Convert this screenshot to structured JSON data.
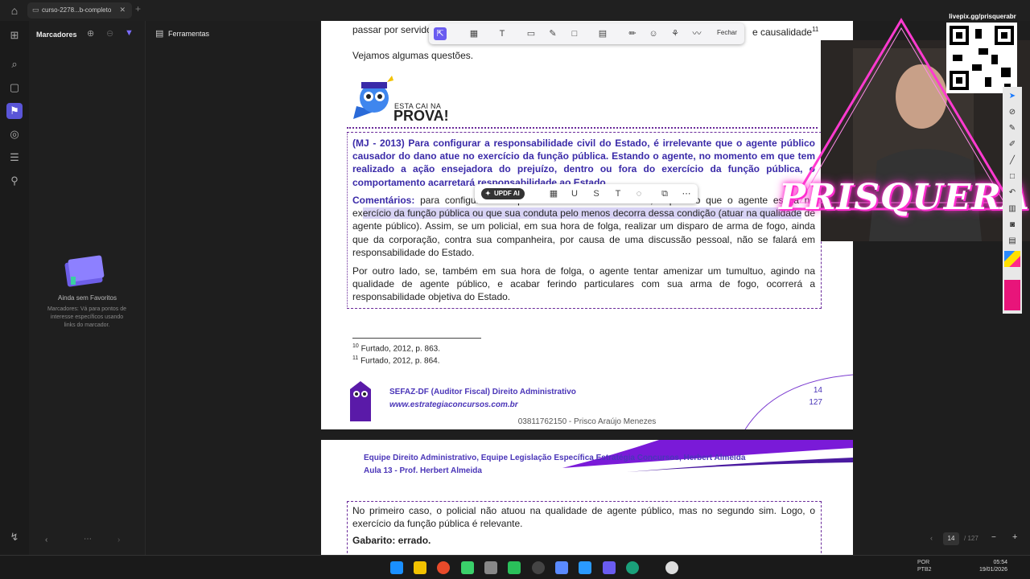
{
  "titlebar": {
    "tab_title": "curso-2278...b-completo"
  },
  "sidebar": {
    "title": "Marcadores",
    "empty_title": "Ainda sem Favoritos",
    "empty_desc": "Marcadores: Vá para pontos de interesse específicos usando links do marcador."
  },
  "tools": {
    "label": "Ferramentas"
  },
  "annotation_toolbar": {
    "close_label": "Fechar"
  },
  "selection_toolbar": {
    "ai_label": "UPDF AI"
  },
  "document": {
    "top_line_start": "passar por servido",
    "top_line_end": "e causalidade",
    "top_sup": "11",
    "intro": "Vejamos algumas questões.",
    "badge_small": "ESTA CAI NA",
    "badge_big": "PROVA!",
    "question": "(MJ - 2013) Para configurar a responsabilidade civil do Estado, é irrelevante que o agente público causador do dano atue no exercício da função pública. Estando o agente, no momento em que tem realizado a ação ensejadora do prejuízo, dentro ou fora do exercício da função pública, o comportamento acarretará responsabilidade ao Estado.",
    "comment_label": "Comentários:",
    "comment_pre": "para configurar a responsabilidade civil do Estado, é preciso que o agente esteja no ex",
    "comment_highlight": "ercício da função pública ou que sua conduta pelo menos decorra dessa condição (atuar na qualidade",
    "comment_post": " de agente público). Assim, se um policial, em sua hora de folga, realizar um disparo de arma de fogo, ainda que da corporação, contra sua companheira, por causa de uma discussão pessoal, não se falará em responsabilidade do Estado.",
    "paragraph2": "Por outro lado, se, também em sua hora de folga, o agente tentar amenizar um tumultuo, agindo na qualidade de agente público, e acabar ferindo particulares com sua arma de fogo, ocorrerá a responsabilidade objetiva do Estado.",
    "footnote1_num": "10",
    "footnote1": "Furtado, 2012, p. 863.",
    "footnote2_num": "11",
    "footnote2": "Furtado, 2012, p. 864.",
    "footer_org": "SEFAZ-DF (Auditor Fiscal) Direito Administrativo",
    "footer_url": "www.estrategiaconcursos.com.br",
    "footer_id": "03811762150 - Prisco Araújo Menezes",
    "page_number": "14",
    "page_total": "127",
    "page2_header1": "Equipe Direito Administrativo, Equipe Legislação Específica Estratégia Concursos, Herbert Almeida",
    "page2_header2": "Aula 13 - Prof. Herbert Almeida",
    "page2_text": "No primeiro caso, o policial não atuou na qualidade de agente público, mas no segundo sim. Logo, o exercício da função pública é relevante.",
    "gabarito": "Gabarito: errado."
  },
  "overlay": {
    "qr_url": "livepix.gg/prisquerabr",
    "name": "PRISQUERA"
  },
  "pagenav": {
    "current": "14",
    "total": "/ 127"
  },
  "taskbar": {
    "lang1": "POR",
    "lang2": "PTB2",
    "time": "05:54",
    "date": "19/01/2026"
  }
}
